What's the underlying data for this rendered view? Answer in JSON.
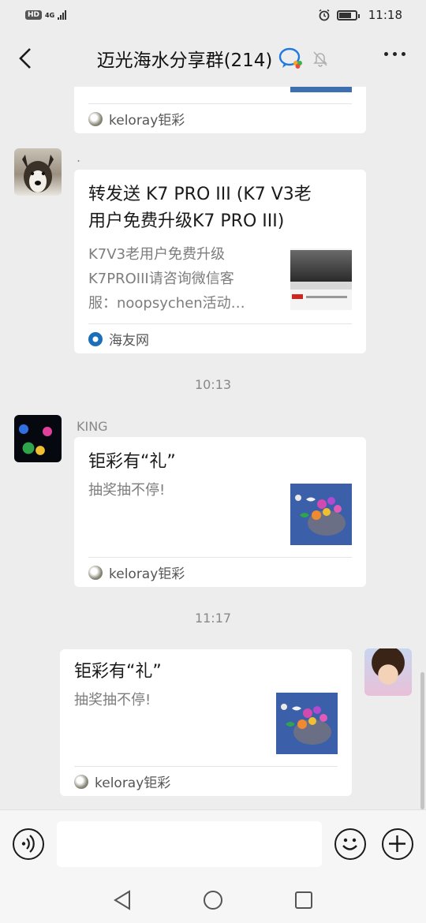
{
  "status": {
    "network": "4G",
    "hd": "HD",
    "time": "11:18"
  },
  "header": {
    "title": "迈光海水分享群(214)"
  },
  "messages": [
    {
      "source": "keloray钜彩"
    },
    {
      "sender": ".",
      "title": "转发送 K7 PRO III (K7 V3老用户免费升级K7 PRO III)",
      "title_line1": "转发送 K7 PRO III (K7 V3老",
      "title_line2": "用户免费升级K7 PRO III)",
      "desc_line1": "K7V3老用户免费升级",
      "desc_line2": "K7PROIII请咨询微信客",
      "desc_line3": "服：noopsychen活动…",
      "source": "海友网"
    },
    {
      "time": "10:13",
      "sender": "KING",
      "title": "钜彩有“礼”",
      "desc": "抽奖抽不停!",
      "source": "keloray钜彩"
    },
    {
      "time": "11:17",
      "title": "钜彩有“礼”",
      "desc": "抽奖抽不停!",
      "source": "keloray钜彩"
    }
  ],
  "colors": {
    "background": "#ededed",
    "card": "#ffffff",
    "accent_blue": "#2f72c8"
  }
}
